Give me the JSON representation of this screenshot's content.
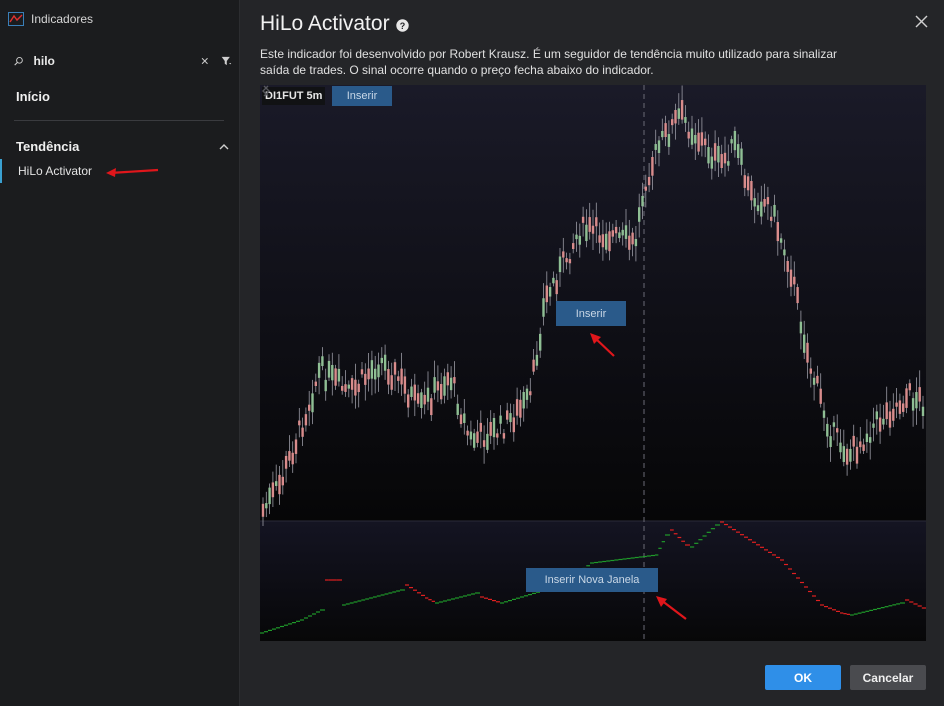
{
  "sidebar": {
    "title": "Indicadores",
    "search_value": "hilo",
    "home_label": "Início",
    "category_label": "Tendência",
    "items": [
      {
        "label": "HiLo Activator"
      }
    ]
  },
  "main": {
    "title": "HiLo Activator",
    "description": "Este indicador foi desenvolvido por Robert Krausz. É um seguidor de tendência muito utilizado para sinalizar saída de trades. O sinal ocorre quando o preço fecha abaixo do indicador.",
    "preview": {
      "symbol_tag": "DI1FUT 5m",
      "insert_top_label": "Inserir",
      "insert_mid_label": "Inserir",
      "insert_new_window_label": "Inserir Nova Janela"
    },
    "ok_label": "OK",
    "cancel_label": "Cancelar"
  },
  "colors": {
    "accent": "#2f8fe8",
    "selected_marker": "#3aa0d0",
    "annotation_arrow": "#e0161b",
    "candle_up": "#8fbf94",
    "candle_down": "#d98c8c",
    "hilo_up": "#1f9a2a",
    "hilo_down": "#e02020"
  },
  "icons": [
    "indicator-app-icon",
    "search-icon",
    "clear-icon",
    "filter-icon",
    "chevron-up-icon",
    "help-icon",
    "close-icon",
    "chevron-left-icon",
    "chevron-right-icon"
  ]
}
